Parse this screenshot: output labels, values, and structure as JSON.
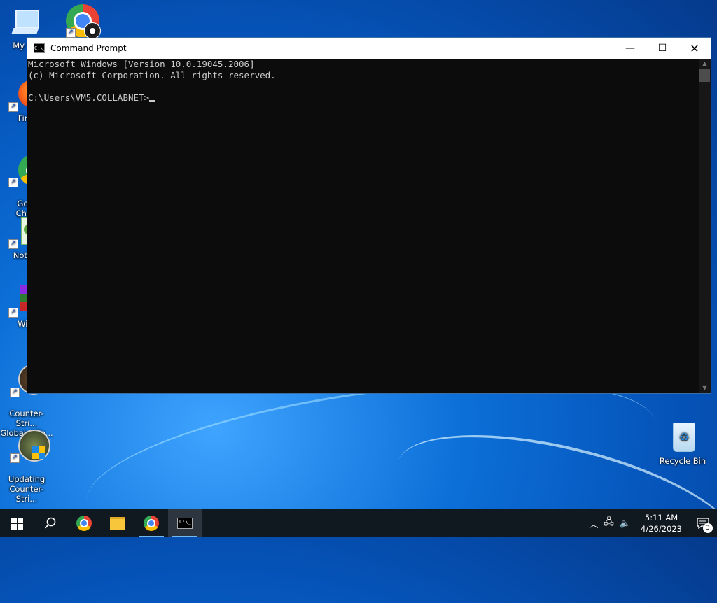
{
  "desktop": {
    "icons": [
      {
        "label": "My Co",
        "icon": "computer-icon"
      },
      {
        "label": "",
        "icon": "chrome-icon"
      },
      {
        "label": "Fire",
        "icon": "firefox-icon"
      },
      {
        "label": "Goo\nChro",
        "icon": "chrome-icon"
      },
      {
        "label": "Notep",
        "icon": "notepad-icon"
      },
      {
        "label": "Win",
        "icon": "winrar-icon"
      },
      {
        "label": "Counter-Stri...\nGlobal Offe...",
        "icon": "csgo-icon"
      },
      {
        "label": "Updating\nCounter-Stri...",
        "icon": "csgo-update-icon"
      },
      {
        "label": "Recycle Bin",
        "icon": "recycle-bin-icon"
      }
    ]
  },
  "window": {
    "title": "Command Prompt",
    "icon_text": "C:\\_",
    "console_lines": [
      "Microsoft Windows [Version 10.0.19045.2006]",
      "(c) Microsoft Corporation. All rights reserved.",
      "",
      "C:\\Users\\VM5.COLLABNET>"
    ],
    "buttons": {
      "minimize": "—",
      "maximize": "☐",
      "close": "✕"
    }
  },
  "taskbar": {
    "clock_time": "5:11 AM",
    "clock_date": "4/26/2023",
    "notification_count": "3",
    "cmd_icon_text": "C:\\_"
  },
  "colors": {
    "console_bg": "#0c0c0c",
    "console_fg": "#cccccc",
    "taskbar_bg": "#101820"
  }
}
